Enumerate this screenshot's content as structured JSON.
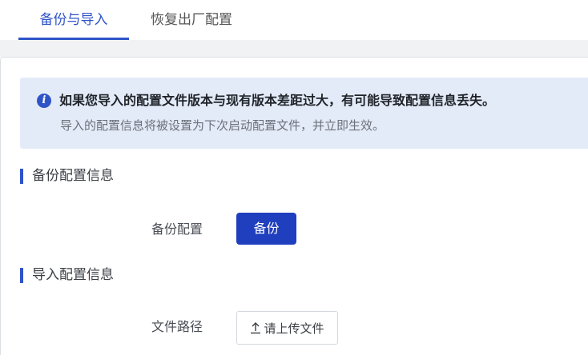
{
  "tabs": [
    {
      "label": "备份与导入",
      "active": true
    },
    {
      "label": "恢复出厂配置",
      "active": false
    }
  ],
  "notice": {
    "icon": "info-icon",
    "icon_glyph": "i",
    "title": "如果您导入的配置文件版本与现有版本差距过大，有可能导致配置信息丢失。",
    "description": "导入的配置信息将被设置为下次启动配置文件，并立即生效。"
  },
  "backup_section": {
    "title": "备份配置信息",
    "field_label": "备份配置",
    "button_label": "备份"
  },
  "import_section": {
    "title": "导入配置信息",
    "field_label": "文件路径",
    "upload_icon": "upload-icon",
    "upload_label": "请上传文件"
  },
  "colors": {
    "accent": "#2f54c8",
    "primary_button": "#1f3fbf",
    "notice_background": "#e4ebf8"
  }
}
